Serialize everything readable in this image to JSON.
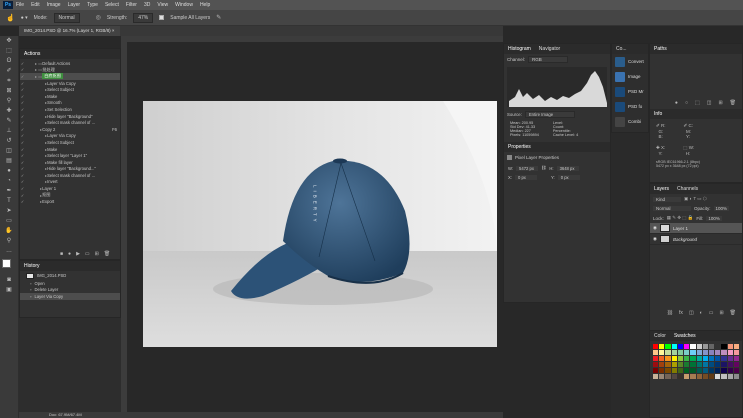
{
  "menubar": {
    "logo": "Ps",
    "items": [
      "File",
      "Edit",
      "Image",
      "Layer",
      "Type",
      "Select",
      "Filter",
      "3D",
      "View",
      "Window",
      "Help"
    ]
  },
  "options": {
    "mode_label": "Mode:",
    "mode_value": "Normal",
    "strength_label": "Strength:",
    "strength_value": "47%",
    "sample_all": "Sample All Layers"
  },
  "document": {
    "tab_title": "IMG_2014.PSD @ 16.7% (Layer 1, RGB/8)",
    "status": "Doc: 67.9M/67.4M"
  },
  "actions": {
    "title": "Actions",
    "rows": [
      {
        "label": "Default Actions",
        "indent": 1,
        "folder": true
      },
      {
        "label": "批处理",
        "indent": 1,
        "folder": true
      },
      {
        "label": "白底抠图",
        "indent": 1,
        "folder": true,
        "selected": true
      },
      {
        "label": "Layer Via Copy",
        "indent": 3
      },
      {
        "label": "Select Subject",
        "indent": 3
      },
      {
        "label": "Make",
        "indent": 3
      },
      {
        "label": "Smooth",
        "indent": 3
      },
      {
        "label": "Set Selection",
        "indent": 3
      },
      {
        "label": "Hide layer \"Background\"",
        "indent": 3
      },
      {
        "label": "Select mask channel of ...",
        "indent": 3
      },
      {
        "label": "Copy 2",
        "indent": 2,
        "key": "F6"
      },
      {
        "label": "Layer Via Copy",
        "indent": 3
      },
      {
        "label": "Select Subject",
        "indent": 3
      },
      {
        "label": "Make",
        "indent": 3
      },
      {
        "label": "Select layer \"Layer 1\"",
        "indent": 3
      },
      {
        "label": "Make fill layer",
        "indent": 3
      },
      {
        "label": "Hide layer \"Background...\"",
        "indent": 3
      },
      {
        "label": "Select mask channel of ...",
        "indent": 3
      },
      {
        "label": "Invert",
        "indent": 3
      },
      {
        "label": "Layer 1",
        "indent": 2
      },
      {
        "label": "抠图",
        "indent": 2
      },
      {
        "label": "Export",
        "indent": 2
      }
    ]
  },
  "history": {
    "title": "History",
    "snapshot": "IMG_2014.PSD",
    "items": [
      "Open",
      "Delete Layer",
      "Layer Via Copy"
    ]
  },
  "histogram": {
    "tabs": [
      "Histogram",
      "Navigator"
    ],
    "channel_label": "Channel:",
    "channel_value": "RGB",
    "source_label": "Source:",
    "source_value": "Entire Image",
    "stats_left": [
      "Mean: 200.95",
      "Std Dev: 41.33",
      "Median: 227",
      "Pixels: 11059894"
    ],
    "stats_right": [
      "Level:",
      "Count:",
      "Percentile:",
      "Cache Level: 4"
    ]
  },
  "properties": {
    "title": "Properties",
    "subtitle": "Pixel Layer Properties",
    "w_label": "W:",
    "w_value": "5472 px",
    "h_label": "H:",
    "h_value": "3648 px",
    "x_label": "X:",
    "x_value": "0 px",
    "y_label": "Y:",
    "y_value": "0 px"
  },
  "side_panel": {
    "title": "Co...",
    "items": [
      "Convert",
      "Image",
      "PSD Mr",
      "PSD fo",
      "Combi"
    ]
  },
  "paths": {
    "title": "Paths"
  },
  "info": {
    "title": "Info",
    "doc": "sRGB IEC61966-2.1 (8bpc)",
    "size": "5472 px x 3648 px (72 ppi)"
  },
  "layers": {
    "tabs": [
      "Layers",
      "Channels"
    ],
    "kind": "Kind",
    "blend": "Normal",
    "opacity_label": "Opacity:",
    "opacity": "100%",
    "lock_label": "Lock:",
    "fill_label": "Fill:",
    "fill": "100%",
    "items": [
      {
        "name": "Layer 1",
        "selected": true
      },
      {
        "name": "Background",
        "selected": false
      }
    ]
  },
  "swatches": {
    "tabs": [
      "Color",
      "Swatches"
    ]
  },
  "photo": {
    "cap_text": "LIBERTY"
  }
}
